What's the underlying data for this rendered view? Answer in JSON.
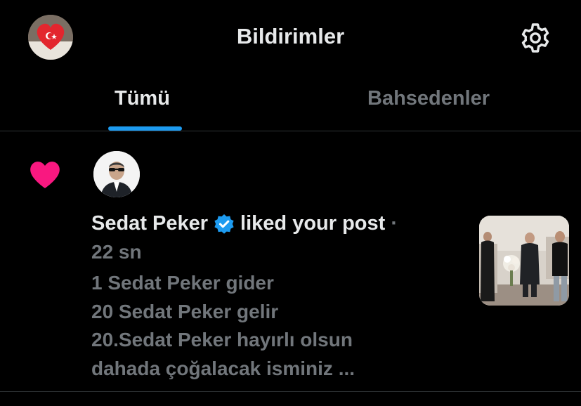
{
  "header": {
    "title": "Bildirimler",
    "avatar_icon": "heart-flag-avatar",
    "settings_icon": "gear-icon"
  },
  "tabs": [
    {
      "label": "Tümü",
      "active": true
    },
    {
      "label": "Bahsedenler",
      "active": false
    }
  ],
  "notification": {
    "type_icon": "heart-icon",
    "actor_name": "Sedat Peker",
    "verified": true,
    "action_text": "liked your post",
    "separator": "·",
    "time": "22 sn",
    "post_lines": [
      "1 Sedat Peker gider",
      "20 Sedat Peker gelir",
      "20.Sedat Peker hayırlı olsun",
      "dahada çoğalacak isminiz ..."
    ]
  },
  "colors": {
    "background": "#000000",
    "accent": "#1d9bf0",
    "like": "#f91880",
    "text_primary": "#e7e9ea",
    "text_secondary": "#71767b"
  }
}
